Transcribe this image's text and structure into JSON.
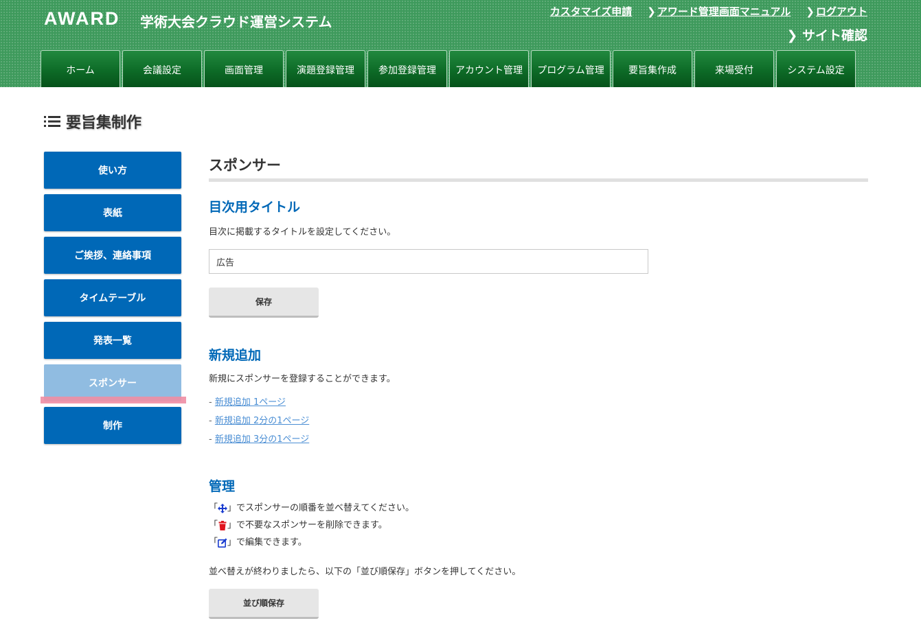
{
  "header": {
    "logo": "AWARD",
    "system_title": "学術大会クラウド運営システム",
    "links": [
      {
        "label": "カスタマイズ申請",
        "chevron": false
      },
      {
        "label": "アワード管理画面マニュアル",
        "chevron": true
      },
      {
        "label": "ログアウト",
        "chevron": true
      }
    ],
    "site_check": "サイト確認",
    "chevron": "❯"
  },
  "nav_tabs": [
    "ホーム",
    "会議設定",
    "画面管理",
    "演題登録管理",
    "参加登録管理",
    "アカウント管理",
    "プログラム管理",
    "要旨集作成",
    "来場受付",
    "システム設定"
  ],
  "page_title": "要旨集制作",
  "sidebar": {
    "items": [
      "使い方",
      "表紙",
      "ご挨拶、連絡事項",
      "タイムテーブル",
      "発表一覧",
      "スポンサー",
      "制作"
    ],
    "active": "スポンサー"
  },
  "main": {
    "section_title": "スポンサー",
    "toc": {
      "heading": "目次用タイトル",
      "description": "目次に掲載するタイトルを設定してください。",
      "input_value": "広告",
      "save_label": "保存"
    },
    "new": {
      "heading": "新規追加",
      "description": "新規にスポンサーを登録することができます。",
      "prefix": "- ",
      "links": [
        "新規追加 1ページ",
        "新規追加 2分の1ページ",
        "新規追加 3分の1ページ"
      ]
    },
    "manage": {
      "heading": "管理",
      "open_bracket": "「",
      "close_bracket": "」",
      "lines": [
        {
          "icon": "move-icon",
          "text": "でスポンサーの順番を並べ替えてください。",
          "color": "#1a3ccf"
        },
        {
          "icon": "trash-icon",
          "text": "で不要なスポンサーを削除できます。",
          "color": "#e0141e"
        },
        {
          "icon": "edit-icon",
          "text": "で編集できます。",
          "color": "#1a3ccf"
        }
      ],
      "note": "並べ替えが終わりましたら、以下の「並び順保存」ボタンを押してください。",
      "sort_save_label": "並び順保存"
    }
  },
  "colors": {
    "header_green": "#3e9a5c",
    "tab_green": "#0d6b27",
    "sidebar_blue": "#0068b7",
    "sidebar_active": "#90bce1",
    "heading_blue": "#0068b7",
    "link_blue": "#4a8ed4",
    "highlight_pink": "#ef8ea4"
  }
}
